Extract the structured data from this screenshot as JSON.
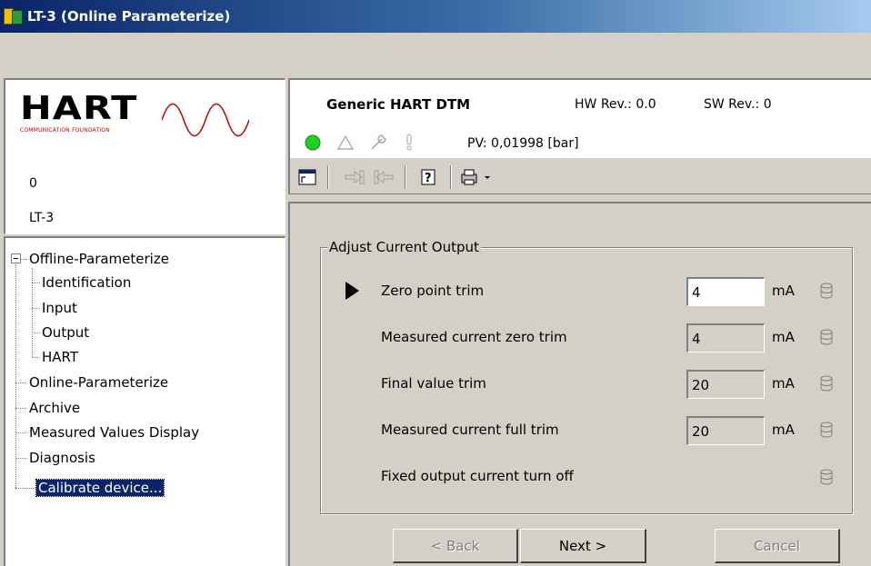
{
  "window": {
    "title": "LT-3 (Online Parameterize)"
  },
  "device_panel": {
    "logo_text": "HART",
    "logo_subtext": "COMMUNICATION FOUNDATION",
    "line1": "0",
    "line2": "LT-3"
  },
  "tree": {
    "root": "Offline-Parameterize",
    "children": [
      "Identification",
      "Input",
      "Output",
      "HART"
    ],
    "items": [
      "Online-Parameterize",
      "Archive",
      "Measured Values Display",
      "Diagnosis"
    ],
    "selected": "Calibrate device..."
  },
  "header": {
    "dtm_name": "Generic HART DTM",
    "hw_rev": "HW Rev.: 0.0",
    "sw_rev": "SW Rev.: 0",
    "pv": "PV: 0,01998 [bar]",
    "status_color": "#1fd11f"
  },
  "toolbar": {
    "icons": [
      "window-icon",
      "upload-icon",
      "download-icon",
      "help-icon",
      "print-icon"
    ]
  },
  "group": {
    "title": "Adjust Current Output",
    "rows": [
      {
        "label": "Zero point trim",
        "value": "4",
        "unit": "mA",
        "editable": true,
        "current": true
      },
      {
        "label": "Measured current zero trim",
        "value": "4",
        "unit": "mA",
        "editable": false
      },
      {
        "label": "Final value trim",
        "value": "20",
        "unit": "mA",
        "editable": false
      },
      {
        "label": "Measured current full trim",
        "value": "20",
        "unit": "mA",
        "editable": false
      },
      {
        "label": "Fixed output current turn off",
        "value": "",
        "unit": "",
        "editable": false
      }
    ]
  },
  "buttons": {
    "back": "<  Back",
    "next": "Next  >",
    "cancel": "Cancel"
  }
}
